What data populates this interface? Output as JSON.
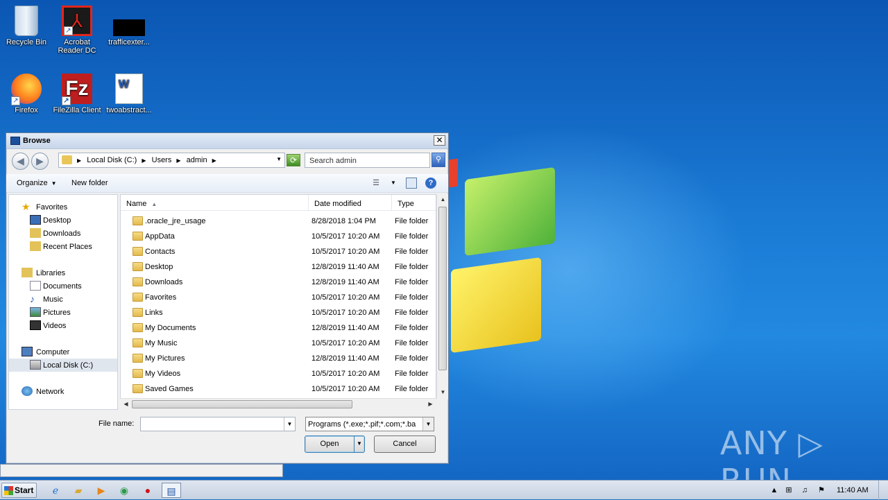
{
  "desktop": {
    "icons": [
      {
        "label": "Recycle Bin",
        "icon": "recycle-bin-icon"
      },
      {
        "label": "Acrobat Reader DC",
        "icon": "acrobat-icon"
      },
      {
        "label": "trafficexter...",
        "icon": "file-icon"
      },
      {
        "label": "Firefox",
        "icon": "firefox-icon"
      },
      {
        "label": "FileZilla Client",
        "icon": "filezilla-icon"
      },
      {
        "label": "twoabstract...",
        "icon": "word-doc-icon"
      }
    ],
    "watermark": "ANY ▷ RUN"
  },
  "dialog": {
    "title": "Browse",
    "close": "✕",
    "breadcrumbs": [
      "Local Disk (C:)",
      "Users",
      "admin"
    ],
    "search_placeholder": "Search admin",
    "toolbar": {
      "organize": "Organize",
      "new_folder": "New folder"
    },
    "nav": {
      "favorites": "Favorites",
      "desktop": "Desktop",
      "downloads": "Downloads",
      "recent": "Recent Places",
      "libraries": "Libraries",
      "documents": "Documents",
      "music": "Music",
      "pictures": "Pictures",
      "videos": "Videos",
      "computer": "Computer",
      "local_disk": "Local Disk (C:)",
      "network": "Network"
    },
    "columns": {
      "name": "Name",
      "date": "Date modified",
      "type": "Type"
    },
    "files": [
      {
        "name": ".oracle_jre_usage",
        "date": "8/28/2018 1:04 PM",
        "type": "File folder"
      },
      {
        "name": "AppData",
        "date": "10/5/2017 10:20 AM",
        "type": "File folder"
      },
      {
        "name": "Contacts",
        "date": "10/5/2017 10:20 AM",
        "type": "File folder"
      },
      {
        "name": "Desktop",
        "date": "12/8/2019 11:40 AM",
        "type": "File folder"
      },
      {
        "name": "Downloads",
        "date": "12/8/2019 11:40 AM",
        "type": "File folder"
      },
      {
        "name": "Favorites",
        "date": "10/5/2017 10:20 AM",
        "type": "File folder"
      },
      {
        "name": "Links",
        "date": "10/5/2017 10:20 AM",
        "type": "File folder"
      },
      {
        "name": "My Documents",
        "date": "12/8/2019 11:40 AM",
        "type": "File folder"
      },
      {
        "name": "My Music",
        "date": "10/5/2017 10:20 AM",
        "type": "File folder"
      },
      {
        "name": "My Pictures",
        "date": "12/8/2019 11:40 AM",
        "type": "File folder"
      },
      {
        "name": "My Videos",
        "date": "10/5/2017 10:20 AM",
        "type": "File folder"
      },
      {
        "name": "Saved Games",
        "date": "10/5/2017 10:20 AM",
        "type": "File folder"
      }
    ],
    "file_name_label": "File name:",
    "file_name_value": "",
    "file_type": "Programs (*.exe;*.pif;*.com;*.ba",
    "open": "Open",
    "cancel": "Cancel"
  },
  "taskbar": {
    "start": "Start",
    "clock": "11:40 AM"
  }
}
